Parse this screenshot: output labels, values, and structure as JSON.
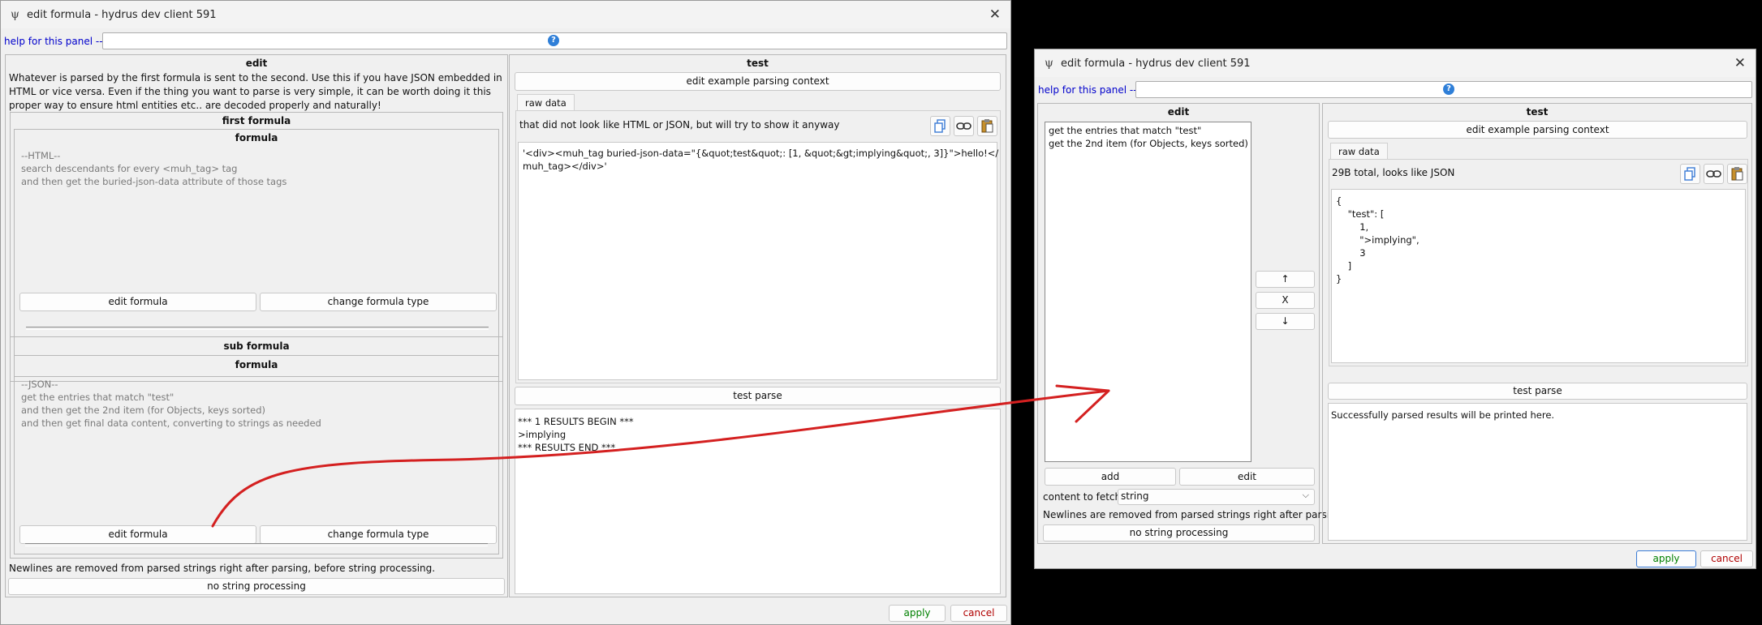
{
  "left_window": {
    "title": "edit formula - hydrus dev client 591",
    "help_link": "help for this panel -->",
    "edit_panel": {
      "title": "edit",
      "description": "Whatever is parsed by the first formula is sent to the second. Use this if you have JSON embedded in HTML or vice versa. Even if the thing you want to parse is very simple, it can be worth doing it this proper way to ensure html entities etc.. are decoded properly and naturally!",
      "first_formula": {
        "section_title": "first formula",
        "box_title": "formula",
        "lines": [
          "--HTML--",
          "search descendants for every <muh_tag> tag",
          "and then get the buried-json-data attribute of those tags"
        ],
        "edit_button": "edit formula",
        "change_button": "change formula type"
      },
      "sub_formula": {
        "section_title": "sub formula",
        "box_title": "formula",
        "lines": [
          "--JSON--",
          "get the entries that match \"test\"",
          "and then get the 2nd item (for Objects, keys sorted)",
          "and then get final data content, converting to strings as needed"
        ],
        "edit_button": "edit formula",
        "change_button": "change formula type"
      },
      "newlines_note": "Newlines are removed from parsed strings right after parsing, before string processing.",
      "string_processing_button": "no string processing"
    },
    "test_panel": {
      "title": "test",
      "context_button": "edit example parsing context",
      "tab": "raw data",
      "status": "that did not look like HTML or JSON, but will try to show it anyway",
      "raw_lines": [
        "'<div><muh_tag buried-json-data=\"{&quot;test&quot;: [1, &quot;&gt;implying&quot;, 3]}\">hello!</",
        "muh_tag></div>'"
      ],
      "test_parse_button": "test parse",
      "result_lines": [
        "*** 1 RESULTS BEGIN ***",
        ">implying",
        "*** RESULTS END ***"
      ]
    },
    "apply": "apply",
    "cancel": "cancel"
  },
  "right_window": {
    "title": "edit formula - hydrus dev client 591",
    "help_link": "help for this panel -->",
    "edit_panel": {
      "title": "edit",
      "list_items": [
        "get the entries that match \"test\"",
        "get the 2nd item (for Objects, keys sorted)"
      ],
      "up_button": "↑",
      "delete_button": "X",
      "down_button": "↓",
      "add_button": "add",
      "edit_button": "edit",
      "content_label": "content to fetch:",
      "content_value": "string",
      "newlines_note": "Newlines are removed from parsed strings right after parsing, ...",
      "string_processing_button": "no string processing"
    },
    "test_panel": {
      "title": "test",
      "context_button": "edit example parsing context",
      "tab": "raw data",
      "status": "29B total, looks like JSON",
      "json_lines": [
        "{",
        "    \"test\": [",
        "        1,",
        "        \">implying\",",
        "        3",
        "    ]",
        "}"
      ],
      "test_parse_button": "test parse",
      "result_text": "Successfully parsed results will be printed here."
    },
    "apply": "apply",
    "cancel": "cancel"
  },
  "icons": [
    "psi-app-icon",
    "close-icon",
    "help-icon",
    "copy-icon",
    "link-icon",
    "paste-icon",
    "chevron-down-icon"
  ],
  "colors": {
    "annotation_arrow": "#d42020",
    "apply_text": "#008000",
    "cancel_text": "#b00000",
    "help_link": "#0000cc"
  }
}
